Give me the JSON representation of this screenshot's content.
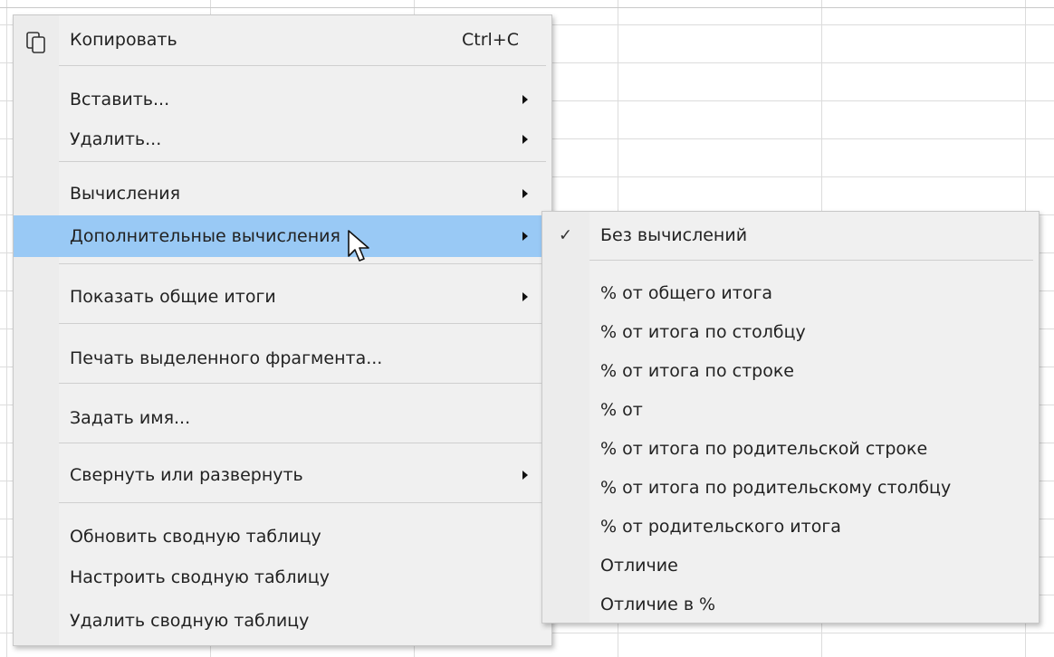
{
  "context_menu": {
    "items": [
      {
        "label": "Копировать",
        "shortcut": "Ctrl+C",
        "icon": "copy-icon"
      },
      {
        "label": "Вставить...",
        "submenu": true
      },
      {
        "label": "Удалить...",
        "submenu": true
      },
      {
        "label": "Вычисления",
        "submenu": true
      },
      {
        "label": "Дополнительные вычисления",
        "submenu": true,
        "highlighted": true
      },
      {
        "label": "Показать общие итоги",
        "submenu": true
      },
      {
        "label": "Печать выделенного фрагмента..."
      },
      {
        "label": "Задать имя..."
      },
      {
        "label": "Свернуть или развернуть",
        "submenu": true
      },
      {
        "label": "Обновить сводную таблицу"
      },
      {
        "label": "Настроить сводную таблицу"
      },
      {
        "label": "Удалить сводную таблицу"
      }
    ]
  },
  "submenu": {
    "items": [
      {
        "label": "Без вычислений",
        "checked": true
      },
      {
        "label": "% от общего итога"
      },
      {
        "label": "% от итога по столбцу"
      },
      {
        "label": "% от итога по строке"
      },
      {
        "label": "% от"
      },
      {
        "label": "% от итога по родительской строке"
      },
      {
        "label": "% от итога по родительскому столбцу"
      },
      {
        "label": "% от родительского итога"
      },
      {
        "label": "Отличие"
      },
      {
        "label": "Отличие в %"
      }
    ]
  },
  "colors": {
    "highlight": "#99c9f5",
    "menu_bg": "#f0f0f0"
  }
}
